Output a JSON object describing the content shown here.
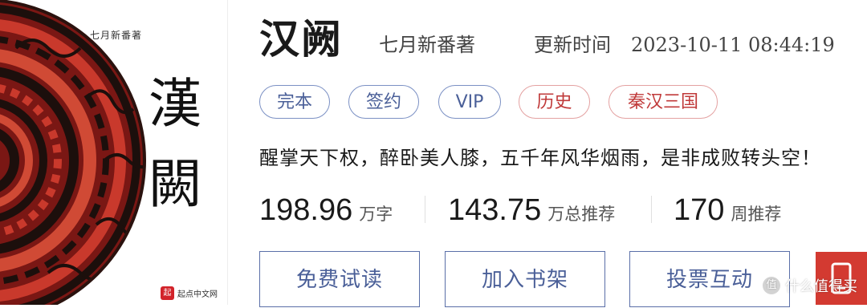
{
  "cover": {
    "author_text": "七月新番著",
    "title_chars": [
      "漢",
      "闕"
    ],
    "publisher": "起点中文网",
    "publisher_mark": "起"
  },
  "book": {
    "title": "汉阙",
    "author": "七月新番著",
    "update_label": "更新时间",
    "update_time": "2023-10-11 08:44:19"
  },
  "tags": [
    {
      "label": "完本",
      "style": "blue"
    },
    {
      "label": "签约",
      "style": "blue"
    },
    {
      "label": "VIP",
      "style": "blue"
    },
    {
      "label": "历史",
      "style": "red"
    },
    {
      "label": "秦汉三国",
      "style": "red"
    }
  ],
  "intro": "醒掌天下权，醉卧美人膝，五千年风华烟雨，是非成败转头空！",
  "stats": [
    {
      "value": "198.96",
      "unit": "万字"
    },
    {
      "value": "143.75",
      "unit": "万总推荐"
    },
    {
      "value": "170",
      "unit": "周推荐"
    }
  ],
  "buttons": {
    "read_free": "免费试读",
    "add_shelf": "加入书架",
    "vote": "投票互动"
  },
  "floating_button": {
    "icon": "mobile-icon"
  },
  "watermark": {
    "text": "什么值得买",
    "mark": "值"
  },
  "colors": {
    "tag_blue": "#4a5f98",
    "tag_red": "#c03a3a",
    "button_border": "#5a6fa8",
    "float_red": "#d33a31"
  }
}
